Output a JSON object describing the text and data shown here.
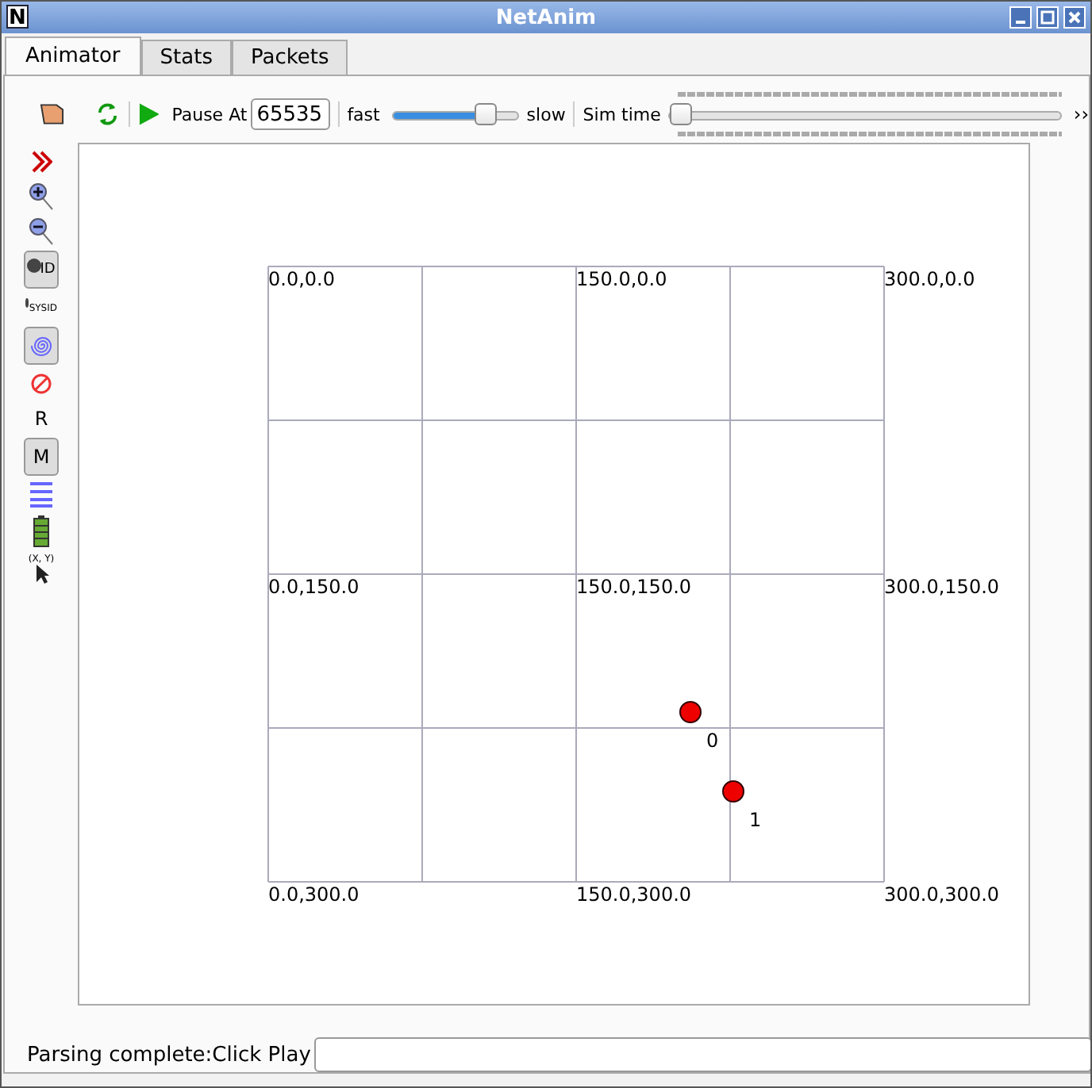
{
  "window": {
    "title": "NetAnim",
    "logo": "N"
  },
  "tabs": [
    {
      "label": "Animator",
      "selected": true
    },
    {
      "label": "Stats",
      "selected": false
    },
    {
      "label": "Packets",
      "selected": false
    }
  ],
  "toolbar": {
    "pause_label": "Pause At",
    "pause_value": "65535",
    "speed": {
      "min_label": "fast",
      "max_label": "slow",
      "level": 0.8
    },
    "sim_time": {
      "label": "Sim time",
      "level": 0
    },
    "more": "››"
  },
  "side_tools": [
    {
      "kind": "forward",
      "pressed": false
    },
    {
      "kind": "zoomin",
      "pressed": false
    },
    {
      "kind": "zoomout",
      "pressed": false
    },
    {
      "kind": "nodeid",
      "pressed": true,
      "text": "ID"
    },
    {
      "kind": "sysid",
      "pressed": false,
      "text": "SYSID"
    },
    {
      "kind": "spiral",
      "pressed": true
    },
    {
      "kind": "blocked",
      "pressed": false
    },
    {
      "kind": "text",
      "pressed": false,
      "text": "R"
    },
    {
      "kind": "text",
      "pressed": true,
      "text": "M"
    },
    {
      "kind": "lines",
      "pressed": false
    },
    {
      "kind": "battery",
      "pressed": false
    },
    {
      "kind": "cursor",
      "pressed": false,
      "text": "(X, Y)"
    }
  ],
  "grid_labels": [
    {
      "text": "0.0,0.0"
    },
    {
      "text": "150.0,0.0"
    },
    {
      "text": "300.0,0.0"
    },
    {
      "text": "0.0,150.0"
    },
    {
      "text": "150.0,150.0"
    },
    {
      "text": "300.0,150.0"
    },
    {
      "text": "0.0,300.0"
    },
    {
      "text": "150.0,300.0"
    },
    {
      "text": "300.0,300.0"
    }
  ],
  "nodes": [
    {
      "label": "0"
    },
    {
      "label": "1"
    }
  ],
  "status": {
    "text": "Parsing complete:Click Play"
  }
}
